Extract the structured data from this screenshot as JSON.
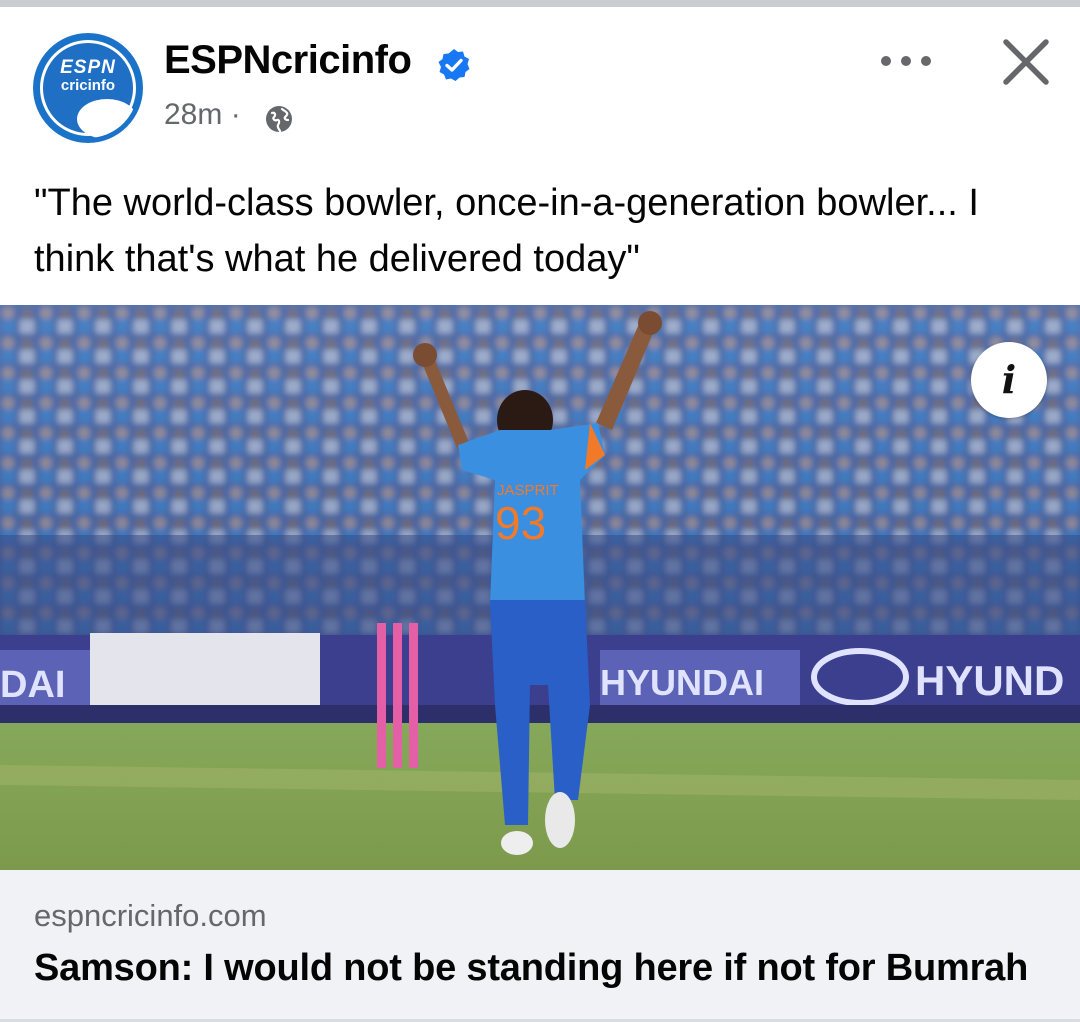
{
  "post": {
    "page_name": "ESPNcricinfo",
    "timestamp": "28m",
    "separator": "·",
    "audience_icon": "globe-icon",
    "verified_icon": "verified-badge-icon",
    "caption": "\"The world-class bowler, once-in-a-generation bowler... I think that's what he delivered today\"",
    "avatar": {
      "logo_top": "ESPN",
      "logo_bottom": "cricinfo"
    }
  },
  "photo": {
    "player_name_on_shirt": "JASPRIT",
    "player_number": "93",
    "board_text_left": "DAI",
    "board_text_mid": "HYUNDAI",
    "board_text_right": "HYUND"
  },
  "link": {
    "domain": "espncricinfo.com",
    "title": "Samson: I would not be standing here if not for Bumrah"
  },
  "icons": [
    "more-options-icon",
    "close-icon",
    "info-icon",
    "globe-icon",
    "verified-badge-icon"
  ],
  "colors": {
    "brand_blue": "#1a73c8",
    "verified_blue": "#1877f2",
    "meta_gray": "#65676b",
    "link_bg": "#f0f2f5"
  }
}
